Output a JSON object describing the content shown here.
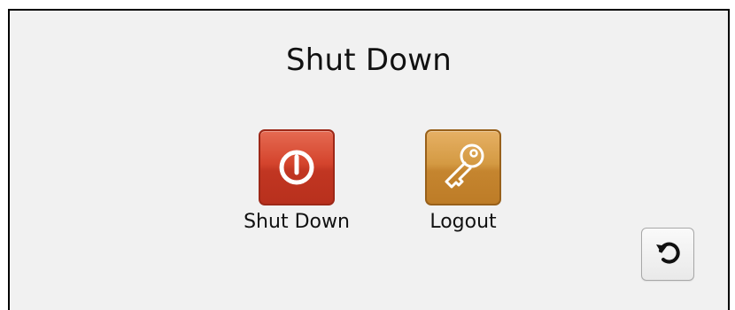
{
  "dialog": {
    "title": "Shut Down"
  },
  "actions": [
    {
      "label": "Shut Down",
      "icon": "power-icon",
      "color": "#c8402a"
    },
    {
      "label": "Logout",
      "icon": "key-icon",
      "color": "#cc8d36"
    }
  ],
  "refresh_button": {
    "icon": "refresh-icon"
  }
}
